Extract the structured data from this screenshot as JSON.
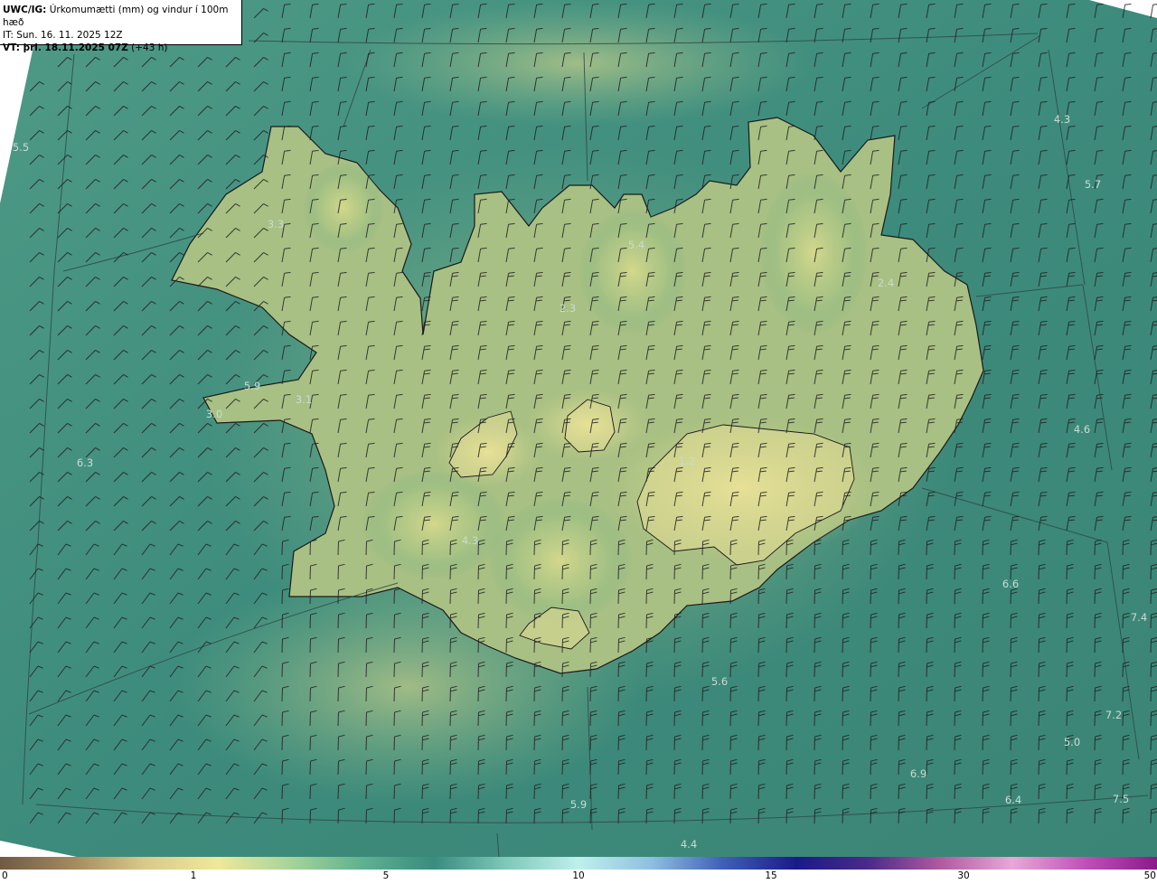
{
  "header": {
    "model_tag": "UWC/IG:",
    "description": " Úrkomumætti (mm) og vindur í 100m hæð",
    "issue_time": "IT: Sun. 16. 11. 2025 12Z",
    "valid_label": "VT:",
    "valid_time": " þri. 18.11.2025 07Z",
    "lead": " (+43 h)"
  },
  "map_values": [
    "5.5",
    "3.3",
    "5.4",
    "4.3",
    "5.7",
    "2.3",
    "2.4",
    "5.9",
    "3.1",
    "3.0",
    "6.3",
    "4.6",
    "1.2",
    "4.3",
    "6.6",
    "7.4",
    "5.6",
    "7.2",
    "5.0",
    "6.9",
    "6.4",
    "7.5",
    "5.9",
    "4.4"
  ],
  "colorbar": {
    "ticks": [
      "0",
      "1",
      "5",
      "10",
      "15",
      "30",
      "50"
    ],
    "colors": [
      "#6f5a44",
      "#a48a5e",
      "#d9c98a",
      "#efe89a",
      "#a8d49a",
      "#5fb28f",
      "#3a8c7e",
      "#7fc9b8",
      "#bff0ec",
      "#8fbfe0",
      "#3f5fb8",
      "#1a1a8a",
      "#4a2a8a",
      "#b05aa0",
      "#e8a8d8",
      "#c050b8",
      "#8a1a8a"
    ]
  },
  "colors": {
    "sea": "#3f8f80",
    "land": "#c9cf86",
    "coast": "#1a1a1a",
    "grid": "#2e4a48"
  }
}
